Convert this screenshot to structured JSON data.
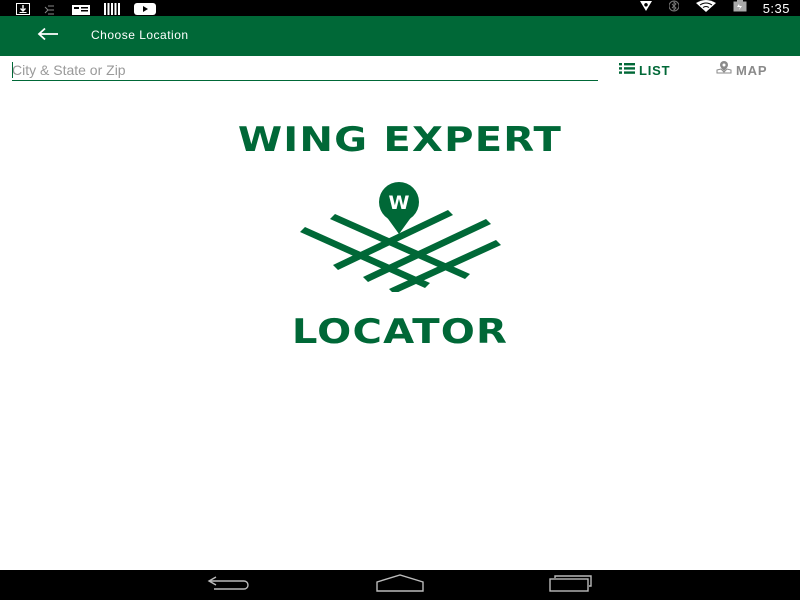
{
  "status_bar": {
    "time": "5:35",
    "left_icons": [
      "download-icon",
      "mail-icon",
      "message-icon",
      "barcode-icon",
      "youtube-icon"
    ],
    "right_icons": [
      "location-icon",
      "bluetooth-icon",
      "wifi-icon",
      "battery-icon"
    ]
  },
  "app_bar": {
    "title": "Choose Location",
    "back_icon": "arrow-back-icon",
    "background": "#006837"
  },
  "search": {
    "placeholder": "City & State or Zip",
    "value": ""
  },
  "view_toggle": {
    "list_label": "LIST",
    "list_icon": "list-icon",
    "map_label": "MAP",
    "map_icon": "map-pin-icon",
    "active": "list",
    "active_color": "#006837",
    "inactive_color": "#8a8a8a"
  },
  "logo": {
    "line1": "WING EXPERT",
    "pin_letter": "W",
    "line2": "LOCATOR",
    "color": "#006837"
  },
  "nav_bar": {
    "buttons": [
      "back-nav-icon",
      "home-nav-icon",
      "recents-nav-icon"
    ]
  }
}
